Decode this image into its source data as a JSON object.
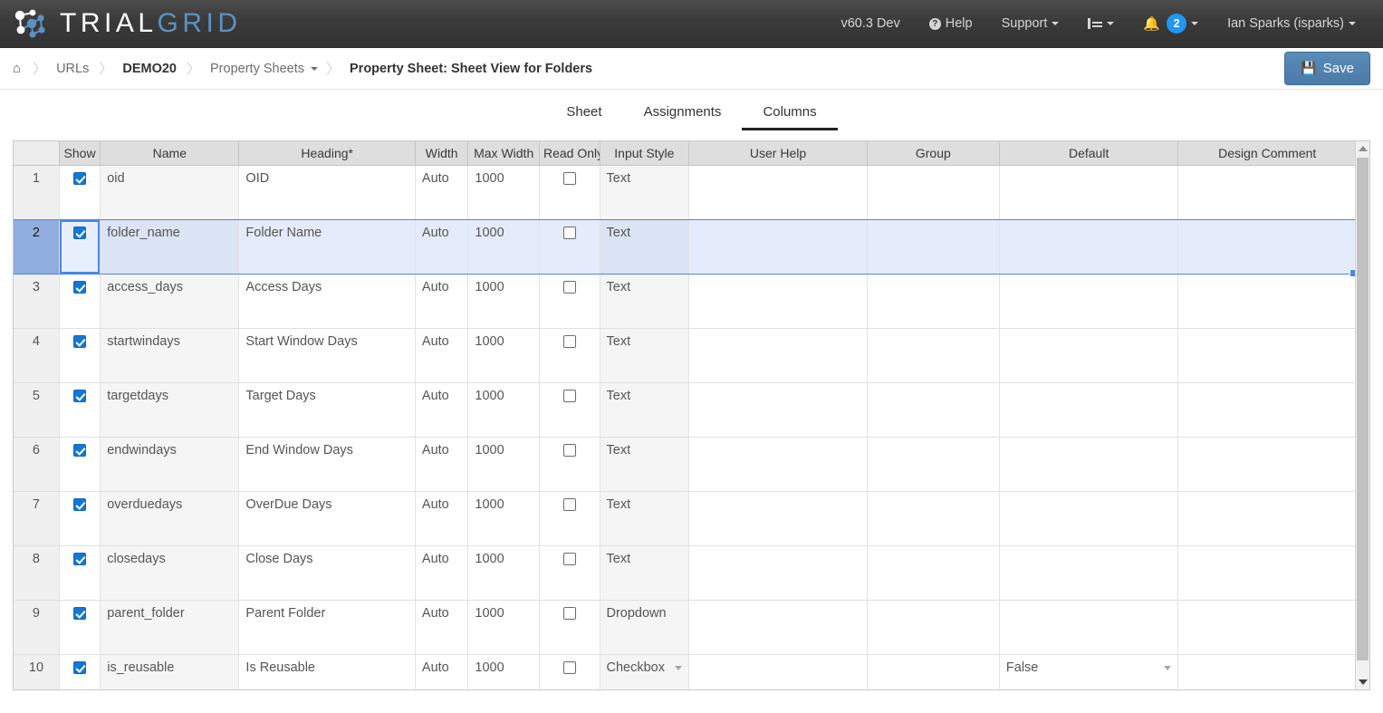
{
  "navbar": {
    "brand_trial": "TRIAL",
    "brand_grid": "GRID",
    "version": "v60.3 Dev",
    "help": "Help",
    "support": "Support",
    "notification_count": "2",
    "user": "Ian Sparks (isparks)"
  },
  "breadcrumb": {
    "home_icon": "home-icon",
    "urls": "URLs",
    "demo": "DEMO20",
    "property_sheets": "Property Sheets",
    "current": "Property Sheet: Sheet View for Folders",
    "separator": "〉",
    "save_label": "Save"
  },
  "tabs": [
    {
      "label": "Sheet",
      "active": false
    },
    {
      "label": "Assignments",
      "active": false
    },
    {
      "label": "Columns",
      "active": true
    }
  ],
  "grid": {
    "columns": [
      "",
      "Show",
      "Name",
      "Heading*",
      "Width",
      "Max Width",
      "Read Only",
      "Input Style",
      "User Help",
      "Group",
      "Default",
      "Design Comment"
    ],
    "selected_row": 2,
    "rows": [
      {
        "n": "1",
        "show": true,
        "name": "oid",
        "heading": "OID",
        "width": "Auto",
        "max_width": "1000",
        "read_only": false,
        "input_style": "Text",
        "input_style_dropdown": false,
        "user_help": "",
        "group": "",
        "default": "",
        "default_dropdown": false,
        "design_comment": ""
      },
      {
        "n": "2",
        "show": true,
        "name": "folder_name",
        "heading": "Folder Name",
        "width": "Auto",
        "max_width": "1000",
        "read_only": false,
        "input_style": "Text",
        "input_style_dropdown": false,
        "user_help": "",
        "group": "",
        "default": "",
        "default_dropdown": false,
        "design_comment": ""
      },
      {
        "n": "3",
        "show": true,
        "name": "access_days",
        "heading": "Access Days",
        "width": "Auto",
        "max_width": "1000",
        "read_only": false,
        "input_style": "Text",
        "input_style_dropdown": false,
        "user_help": "",
        "group": "",
        "default": "",
        "default_dropdown": false,
        "design_comment": ""
      },
      {
        "n": "4",
        "show": true,
        "name": "startwindays",
        "heading": "Start Window Days",
        "width": "Auto",
        "max_width": "1000",
        "read_only": false,
        "input_style": "Text",
        "input_style_dropdown": false,
        "user_help": "",
        "group": "",
        "default": "",
        "default_dropdown": false,
        "design_comment": ""
      },
      {
        "n": "5",
        "show": true,
        "name": "targetdays",
        "heading": "Target Days",
        "width": "Auto",
        "max_width": "1000",
        "read_only": false,
        "input_style": "Text",
        "input_style_dropdown": false,
        "user_help": "",
        "group": "",
        "default": "",
        "default_dropdown": false,
        "design_comment": ""
      },
      {
        "n": "6",
        "show": true,
        "name": "endwindays",
        "heading": "End Window Days",
        "width": "Auto",
        "max_width": "1000",
        "read_only": false,
        "input_style": "Text",
        "input_style_dropdown": false,
        "user_help": "",
        "group": "",
        "default": "",
        "default_dropdown": false,
        "design_comment": ""
      },
      {
        "n": "7",
        "show": true,
        "name": "overduedays",
        "heading": "OverDue Days",
        "width": "Auto",
        "max_width": "1000",
        "read_only": false,
        "input_style": "Text",
        "input_style_dropdown": false,
        "user_help": "",
        "group": "",
        "default": "",
        "default_dropdown": false,
        "design_comment": ""
      },
      {
        "n": "8",
        "show": true,
        "name": "closedays",
        "heading": "Close Days",
        "width": "Auto",
        "max_width": "1000",
        "read_only": false,
        "input_style": "Text",
        "input_style_dropdown": false,
        "user_help": "",
        "group": "",
        "default": "",
        "default_dropdown": false,
        "design_comment": ""
      },
      {
        "n": "9",
        "show": true,
        "name": "parent_folder",
        "heading": "Parent Folder",
        "width": "Auto",
        "max_width": "1000",
        "read_only": false,
        "input_style": "Dropdown",
        "input_style_dropdown": false,
        "user_help": "",
        "group": "",
        "default": "",
        "default_dropdown": false,
        "design_comment": ""
      },
      {
        "n": "10",
        "show": true,
        "name": "is_reusable",
        "heading": "Is Reusable",
        "width": "Auto",
        "max_width": "1000",
        "read_only": false,
        "input_style": "Checkbox",
        "input_style_dropdown": true,
        "user_help": "",
        "group": "",
        "default": "False",
        "default_dropdown": true,
        "design_comment": ""
      }
    ]
  },
  "colors": {
    "accent": "#5b92c4",
    "badge": "#2196f3",
    "selection": "#4a86e8",
    "save": "#4b7ba8"
  }
}
